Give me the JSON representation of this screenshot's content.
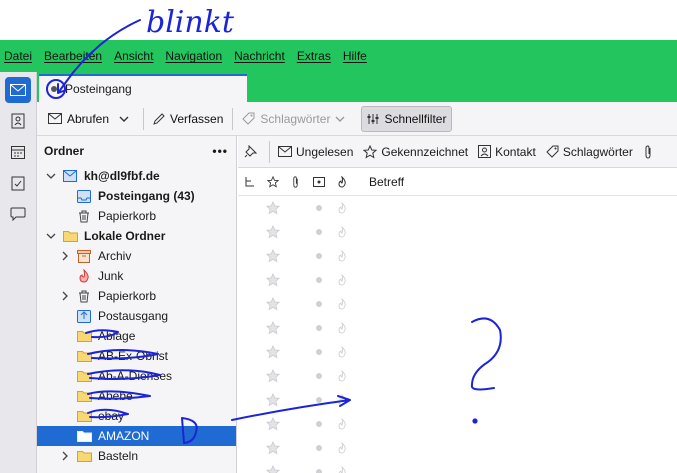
{
  "menu": [
    "Datei",
    "Bearbeiten",
    "Ansicht",
    "Navigation",
    "Nachricht",
    "Extras",
    "Hilfe"
  ],
  "tab": {
    "title": "Posteingang"
  },
  "toolbar": {
    "get_mail": "Abrufen",
    "compose": "Verfassen",
    "tags": "Schlagwörter",
    "quick_filter": "Schnellfilter"
  },
  "folder_pane": {
    "header": "Ordner",
    "more": "•••",
    "folders": [
      {
        "label": "kh@dl9fbf.de",
        "bold": true,
        "icon": "account-icon"
      },
      {
        "label": "Posteingang (43)",
        "bold": true,
        "icon": "inbox-icon"
      },
      {
        "label": "Papierkorb",
        "bold": false,
        "icon": "trash-icon"
      },
      {
        "label": "Lokale Ordner",
        "bold": true,
        "icon": "folder-icon"
      },
      {
        "label": "Archiv",
        "bold": false,
        "icon": "archive-icon"
      },
      {
        "label": "Junk",
        "bold": false,
        "icon": "junk-icon"
      },
      {
        "label": "Papierkorb",
        "bold": false,
        "icon": "trash-icon"
      },
      {
        "label": "Postausgang",
        "bold": false,
        "icon": "outbox-icon"
      },
      {
        "label": "Ablage",
        "bold": false,
        "icon": "folder-icon"
      },
      {
        "label": "AB-Ex-Obrist",
        "bold": false,
        "icon": "folder-icon"
      },
      {
        "label": "Ab-A-Dienses",
        "bold": false,
        "icon": "folder-icon"
      },
      {
        "label": "Abebe",
        "bold": false,
        "icon": "folder-icon"
      },
      {
        "label": "ebay",
        "bold": false,
        "icon": "folder-icon"
      },
      {
        "label": "AMAZON",
        "bold": false,
        "icon": "folder-icon",
        "selected": true
      },
      {
        "label": "Basteln",
        "bold": false,
        "icon": "folder-icon"
      }
    ]
  },
  "quick_filter": {
    "unread": "Ungelesen",
    "starred": "Gekennzeichnet",
    "contact": "Kontakt",
    "tags": "Schlagwörter"
  },
  "thread_pane": {
    "subject_header": "Betreff"
  },
  "annotation": {
    "text": "blinkt",
    "question": "?"
  },
  "colors": {
    "accent": "#1f6bd3",
    "menubar_bg": "#22c55e",
    "ink": "#1c24d8"
  }
}
